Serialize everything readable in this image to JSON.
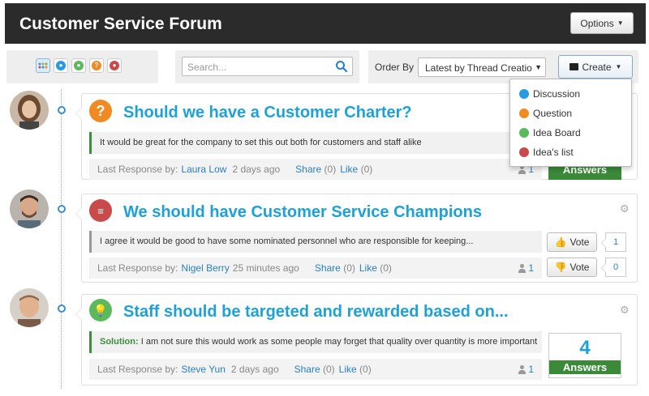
{
  "header": {
    "title": "Customer Service Forum",
    "options_label": "Options"
  },
  "toolbar": {
    "search_placeholder": "Search...",
    "order_by_label": "Order By",
    "order_by_value": "Latest by Thread Creation",
    "create_label": "Create"
  },
  "create_menu": {
    "items": [
      {
        "label": "Discussion",
        "icon": "discussion-icon",
        "color": "#2a9ae0"
      },
      {
        "label": "Question",
        "icon": "question-icon",
        "color": "#f08a24"
      },
      {
        "label": "Idea Board",
        "icon": "idea-icon",
        "color": "#5cb85c"
      },
      {
        "label": "Idea's list",
        "icon": "idea-list-icon",
        "color": "#c94a4a"
      }
    ]
  },
  "threads": [
    {
      "title": "Should we have a Customer Charter?",
      "type_icon": "question-icon",
      "icon_color": "#f08a24",
      "excerpt": "It would be great for the company to set this out both for customers and staff alike",
      "last_response_label": "Last Response by:",
      "author": "Laura Low",
      "when": "2 days ago",
      "share_label": "Share",
      "share_count": "(0)",
      "like_label": "Like",
      "like_count": "(0)",
      "participants": "1",
      "answers_label": "Answers"
    },
    {
      "title": "We should have Customer Service Champions",
      "type_icon": "idea-list-icon",
      "icon_color": "#c94a4a",
      "excerpt": "I agree it would be good to have some nominated personnel who are responsible for keeping...",
      "last_response_label": "Last Response by:",
      "author": "Nigel Berry",
      "when": "25 minutes ago",
      "share_label": "Share",
      "share_count": "(0)",
      "like_label": "Like",
      "like_count": "(0)",
      "participants": "1",
      "vote_label": "Vote",
      "up_votes": "1",
      "down_votes": "0"
    },
    {
      "title": "Staff should be targeted and rewarded based on...",
      "type_icon": "idea-icon",
      "icon_color": "#5cb85c",
      "solution_label": "Solution:",
      "excerpt": "I am not sure this would work as some people may forget that quality over quantity is more important",
      "last_response_label": "Last Response by:",
      "author": "Steve Yun",
      "when": "2 days ago",
      "share_label": "Share",
      "share_count": "(0)",
      "like_label": "Like",
      "like_count": "(0)",
      "participants": "1",
      "answers_count": "4",
      "answers_label": "Answers"
    }
  ]
}
